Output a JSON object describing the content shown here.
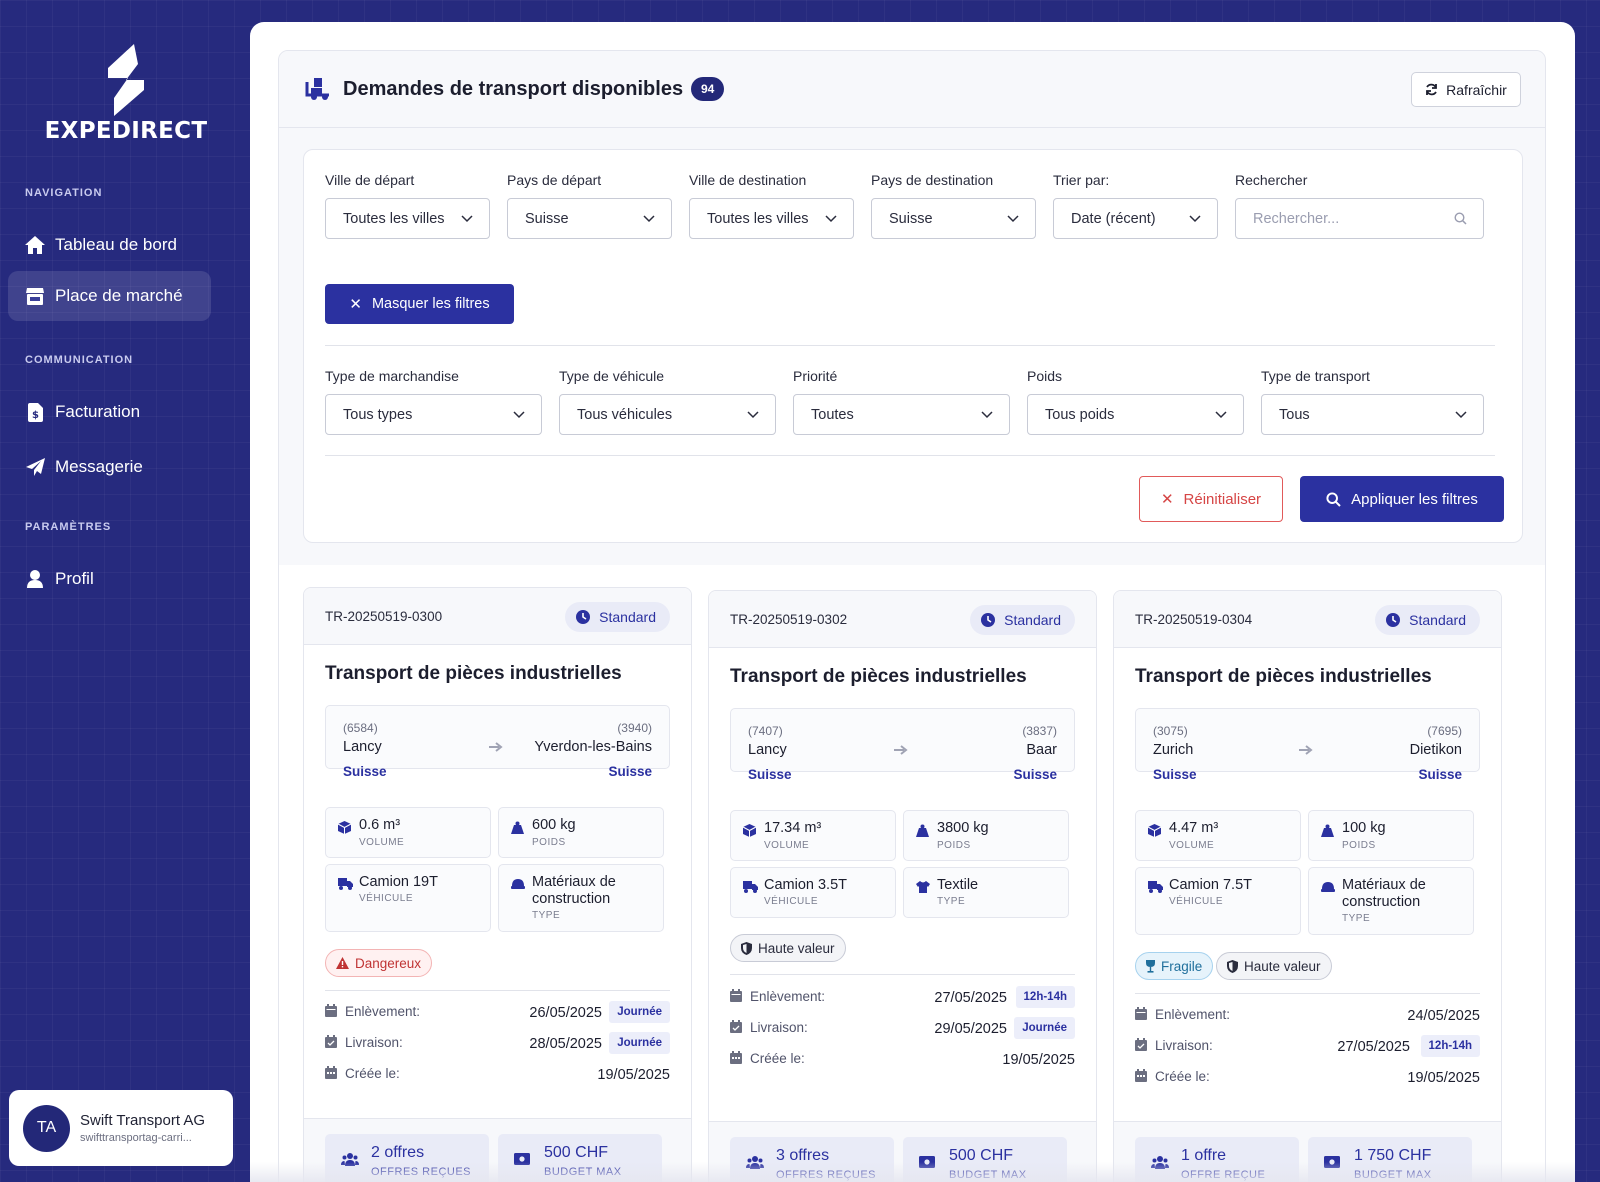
{
  "brand": {
    "name": "EXPEDIRECT"
  },
  "sidebar": {
    "sections": {
      "navigation": "NAVIGATION",
      "communication": "COMMUNICATION",
      "settings": "PARAMÈTRES"
    },
    "items": {
      "dashboard": "Tableau de bord",
      "marketplace": "Place de marché",
      "billing": "Facturation",
      "messaging": "Messagerie",
      "profile": "Profil"
    },
    "user": {
      "initials": "TA",
      "name": "Swift Transport AG",
      "email": "swifttransportag-carri..."
    }
  },
  "header": {
    "title": "Demandes de transport disponibles",
    "count": "94",
    "refresh_label": "Rafraîchir"
  },
  "filters": {
    "departure_city": {
      "label": "Ville de départ",
      "value": "Toutes les villes"
    },
    "departure_country": {
      "label": "Pays de départ",
      "value": "Suisse"
    },
    "destination_city": {
      "label": "Ville de destination",
      "value": "Toutes les villes"
    },
    "destination_country": {
      "label": "Pays de destination",
      "value": "Suisse"
    },
    "sort": {
      "label": "Trier par:",
      "value": "Date (récent)"
    },
    "search": {
      "label": "Rechercher",
      "placeholder": "Rechercher..."
    },
    "hide_label": "Masquer les filtres",
    "goods_type": {
      "label": "Type de marchandise",
      "value": "Tous types"
    },
    "vehicle_type": {
      "label": "Type de véhicule",
      "value": "Tous véhicules"
    },
    "priority": {
      "label": "Priorité",
      "value": "Toutes"
    },
    "weight": {
      "label": "Poids",
      "value": "Tous poids"
    },
    "transport_type": {
      "label": "Type de transport",
      "value": "Tous"
    },
    "reset_label": "Réinitialiser",
    "apply_label": "Appliquer les filtres"
  },
  "labels": {
    "volume": "VOLUME",
    "weight": "POIDS",
    "vehicle": "VÉHICULE",
    "type": "TYPE",
    "pickup": "Enlèvement:",
    "delivery": "Livraison:",
    "created": "Créée le:",
    "budget": "BUDGET MAX"
  },
  "cards": [
    {
      "ref": "TR-20250519-0300",
      "priority": "Standard",
      "title": "Transport de pièces industrielles",
      "from": {
        "code": "(6584)",
        "city": "Lancy",
        "country": "Suisse"
      },
      "to": {
        "code": "(3940)",
        "city": "Yverdon-les-Bains",
        "country": "Suisse"
      },
      "volume": "0.6 m³",
      "weight": "600 kg",
      "vehicle": "Camion 19T",
      "goods": "Matériaux de construction",
      "tags": [
        "Dangereux"
      ],
      "pickup": {
        "date": "26/05/2025",
        "slot": "Journée"
      },
      "delivery": {
        "date": "28/05/2025",
        "slot": "Journée"
      },
      "created": "19/05/2025",
      "offers": "2 offres",
      "offers_caption": "OFFRES REÇUES",
      "budget": "500 CHF"
    },
    {
      "ref": "TR-20250519-0302",
      "priority": "Standard",
      "title": "Transport de pièces industrielles",
      "from": {
        "code": "(7407)",
        "city": "Lancy",
        "country": "Suisse"
      },
      "to": {
        "code": "(3837)",
        "city": "Baar",
        "country": "Suisse"
      },
      "volume": "17.34 m³",
      "weight": "3800 kg",
      "vehicle": "Camion 3.5T",
      "goods": "Textile",
      "tags": [
        "Haute valeur"
      ],
      "pickup": {
        "date": "27/05/2025",
        "slot": "12h-14h"
      },
      "delivery": {
        "date": "29/05/2025",
        "slot": "Journée"
      },
      "created": "19/05/2025",
      "offers": "3 offres",
      "offers_caption": "OFFRES REÇUES",
      "budget": "500 CHF"
    },
    {
      "ref": "TR-20250519-0304",
      "priority": "Standard",
      "title": "Transport de pièces industrielles",
      "from": {
        "code": "(3075)",
        "city": "Zurich",
        "country": "Suisse"
      },
      "to": {
        "code": "(7695)",
        "city": "Dietikon",
        "country": "Suisse"
      },
      "volume": "4.47 m³",
      "weight": "100 kg",
      "vehicle": "Camion 7.5T",
      "goods": "Matériaux de construction",
      "tags": [
        "Fragile",
        "Haute valeur"
      ],
      "pickup": {
        "date": "24/05/2025",
        "slot": ""
      },
      "delivery": {
        "date": "27/05/2025",
        "slot": "12h-14h"
      },
      "created": "19/05/2025",
      "offers": "1 offre",
      "offers_caption": "OFFRE REÇUE",
      "budget": "1 750 CHF"
    }
  ]
}
